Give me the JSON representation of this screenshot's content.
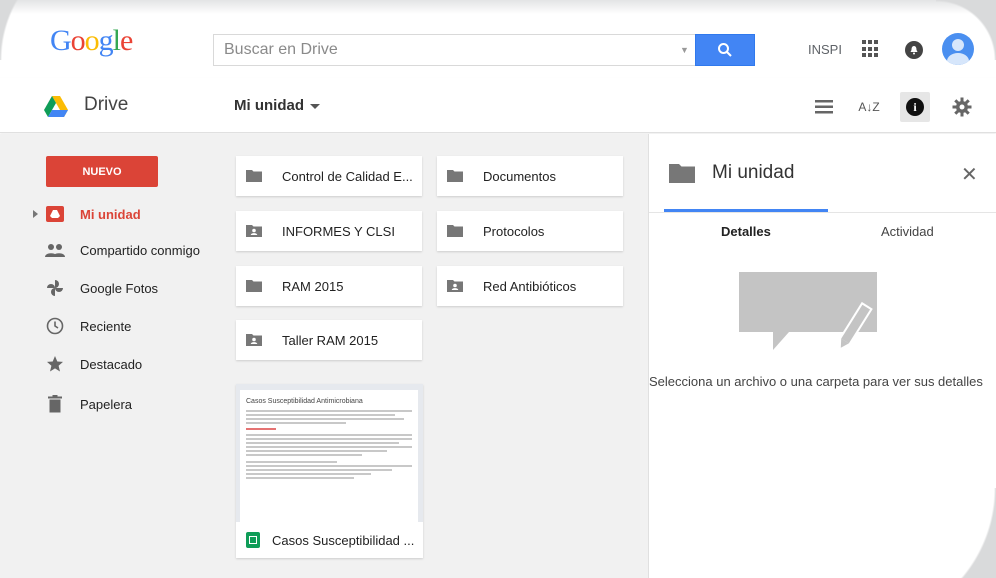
{
  "header": {
    "logo_text": "Google",
    "search_placeholder": "Buscar en Drive",
    "account_label": "INSPI"
  },
  "toolbar": {
    "app_title": "Drive",
    "breadcrumb": "Mi unidad"
  },
  "sidebar": {
    "new_button": "NUEVO",
    "items": [
      {
        "label": "Mi unidad",
        "icon": "my-drive-icon",
        "active": true
      },
      {
        "label": "Compartido conmigo",
        "icon": "shared-icon"
      },
      {
        "label": "Google Fotos",
        "icon": "photos-icon"
      },
      {
        "label": "Reciente",
        "icon": "clock-icon"
      },
      {
        "label": "Destacado",
        "icon": "star-icon"
      },
      {
        "label": "Papelera",
        "icon": "trash-icon"
      }
    ]
  },
  "main": {
    "folders": [
      {
        "label": "Control de Calidad E...",
        "shared": false
      },
      {
        "label": "Documentos",
        "shared": false
      },
      {
        "label": "INFORMES Y CLSI",
        "shared": true
      },
      {
        "label": "Protocolos",
        "shared": false
      },
      {
        "label": "RAM 2015",
        "shared": false
      },
      {
        "label": "Red Antibióticos",
        "shared": true
      },
      {
        "label": "Taller RAM 2015",
        "shared": true
      }
    ],
    "file": {
      "name": "Casos Susceptibilidad ...",
      "preview_title": "Casos Susceptibilidad Antimicrobiana"
    }
  },
  "details": {
    "title": "Mi unidad",
    "tabs": [
      "Detalles",
      "Actividad"
    ],
    "empty_message": "Selecciona un archivo o una carpeta para ver sus detalles"
  },
  "colors": {
    "accent_blue": "#4285f4",
    "new_red": "#db4437",
    "sheets_green": "#0f9d58"
  }
}
